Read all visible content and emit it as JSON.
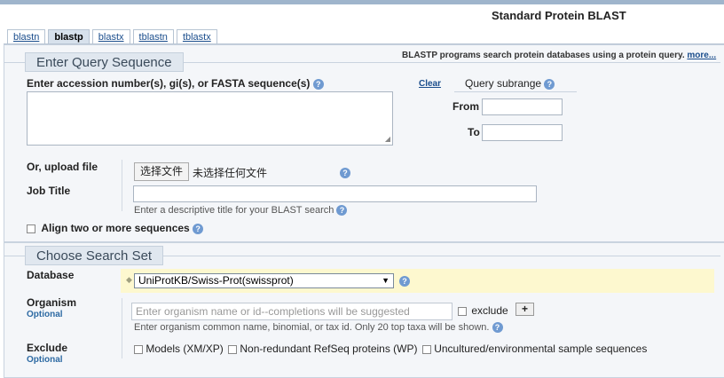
{
  "page": {
    "title": "Standard Protein BLAST"
  },
  "tabs": [
    {
      "label": "blastn",
      "active": false
    },
    {
      "label": "blastp",
      "active": true
    },
    {
      "label": "blastx",
      "active": false
    },
    {
      "label": "tblastn",
      "active": false
    },
    {
      "label": "tblastx",
      "active": false
    }
  ],
  "info": {
    "description": "BLASTP programs search protein databases using a protein query.",
    "more_link": "more..."
  },
  "query": {
    "section_title": "Enter Query Sequence",
    "accession_label": "Enter accession number(s), gi(s), or FASTA sequence(s)",
    "clear_label": "Clear",
    "textarea_value": "",
    "subrange_label": "Query subrange",
    "from_label": "From",
    "to_label": "To",
    "from_value": "",
    "to_value": "",
    "upload_label": "Or, upload file",
    "file_button": "选择文件",
    "file_status": "未选择任何文件",
    "job_title_label": "Job Title",
    "job_title_value": "",
    "job_title_hint": "Enter a descriptive title for your BLAST search",
    "align_label": "Align two or more sequences"
  },
  "search_set": {
    "section_title": "Choose Search Set",
    "database_label": "Database",
    "database_value": "UniProtKB/Swiss-Prot(swissprot)",
    "organism_label": "Organism",
    "optional_label": "Optional",
    "organism_placeholder": "Enter organism name or id--completions will be suggested",
    "exclude_checkbox_label": "exclude",
    "plus_label": "+",
    "organism_hint": "Enter organism common name, binomial, or tax id. Only 20 top taxa will be shown.",
    "exclude_label": "Exclude",
    "exclude_optional_label": "Optional",
    "exclude_options": [
      "Models (XM/XP)",
      "Non-redundant RefSeq proteins (WP)",
      "Uncultured/environmental sample sequences"
    ]
  },
  "icons": {
    "help": "help-icon",
    "dropdown": "chevron-down-icon"
  },
  "colors": {
    "accent_link": "#1a4d8c",
    "highlight_row": "#fdf8cf",
    "help_icon": "#6f9ad1"
  }
}
